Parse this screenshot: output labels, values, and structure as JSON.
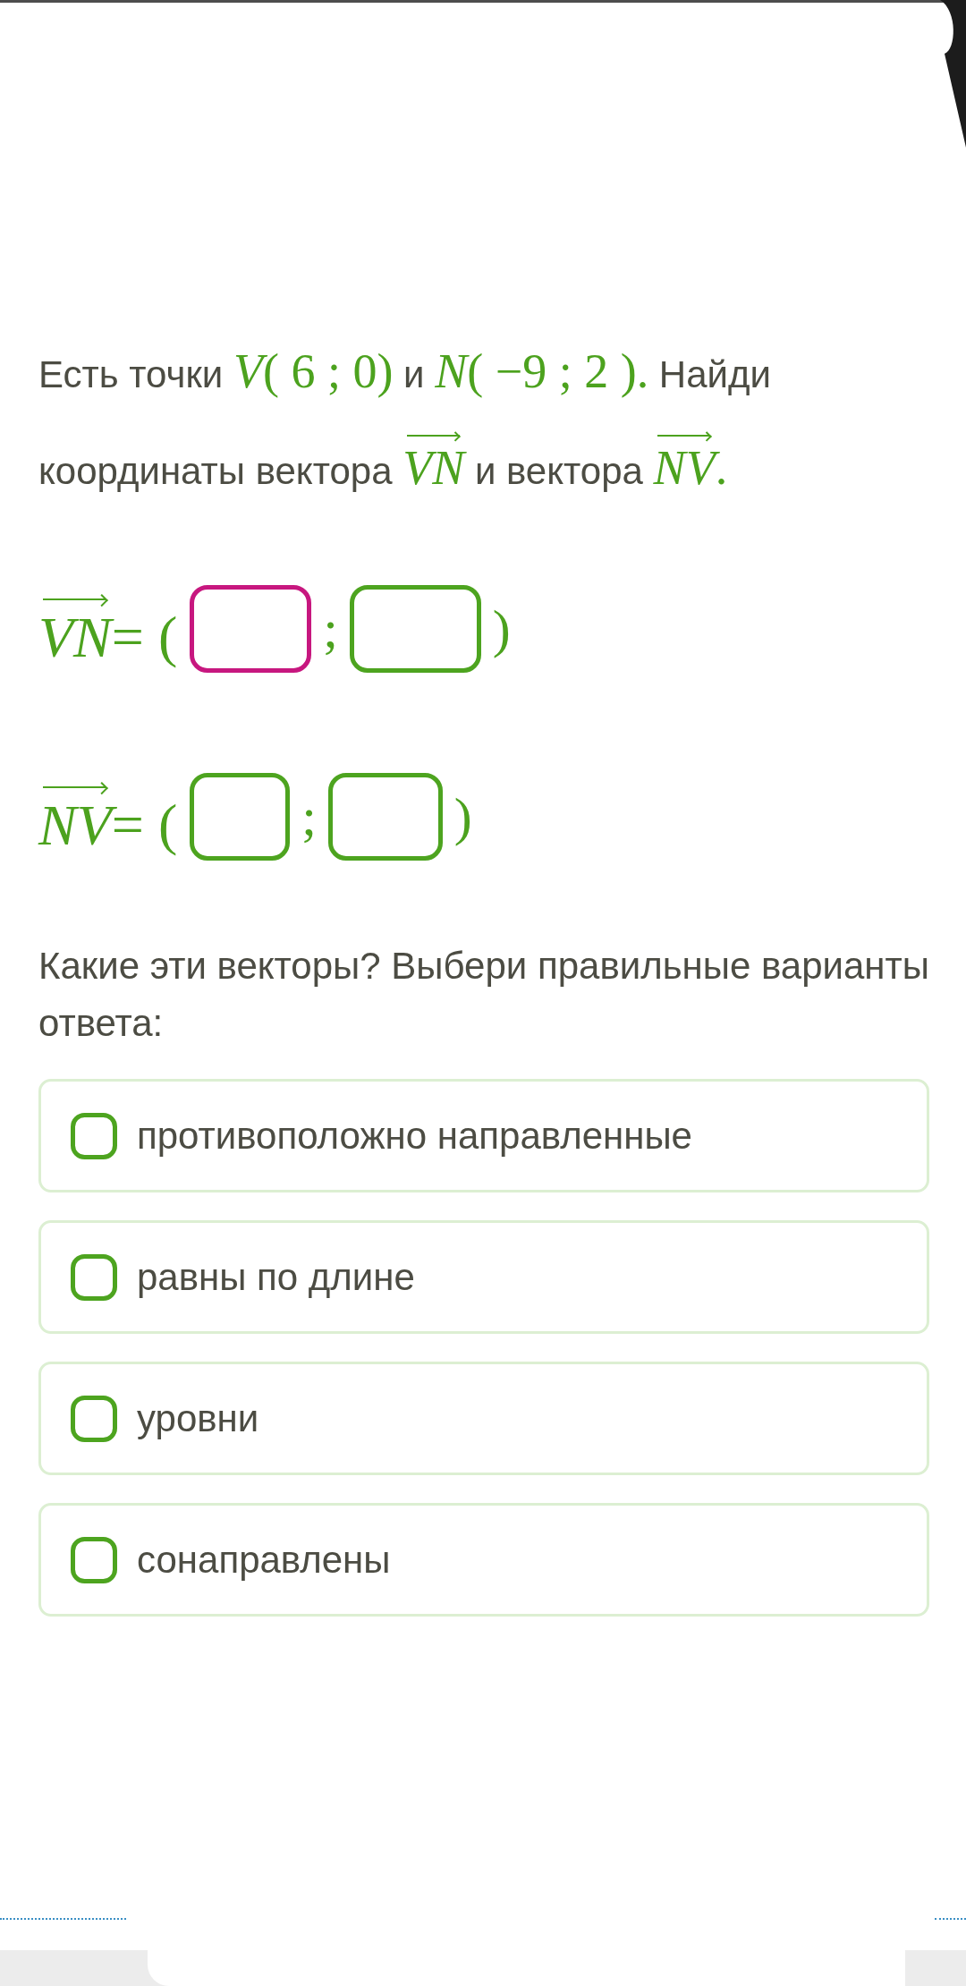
{
  "statement": [
    {
      "kind": "text",
      "text": "Есть точки "
    },
    {
      "kind": "math",
      "text": "V( 6 ; 0)"
    },
    {
      "kind": "text",
      "text": " и "
    },
    {
      "kind": "math",
      "text": "N( −9 ; 2 )."
    },
    {
      "kind": "text",
      "text": " Найди координаты вектора "
    },
    {
      "kind": "vector",
      "text": "VN"
    },
    {
      "kind": "text",
      "text": " и вектора "
    },
    {
      "kind": "vector",
      "text": "NV"
    },
    {
      "kind": "math",
      "text": "."
    }
  ],
  "equations": [
    {
      "vector": "VN",
      "open": "= (",
      "separator": ";",
      "close": ")",
      "fields": [
        {
          "focused": true
        },
        {
          "focused": false
        }
      ]
    },
    {
      "vector": "NV",
      "open": "= (",
      "separator": ";",
      "close": ")",
      "fields": [
        {
          "focused": false
        },
        {
          "focused": false
        }
      ]
    }
  ],
  "question": "Какие эти векторы? Выбери правильные варианты ответа:",
  "options": [
    {
      "label": "противоположно направленные",
      "checked": false
    },
    {
      "label": "равны по длине",
      "checked": false
    },
    {
      "label": "уровни",
      "checked": false
    },
    {
      "label": "сонаправлены",
      "checked": false
    }
  ]
}
